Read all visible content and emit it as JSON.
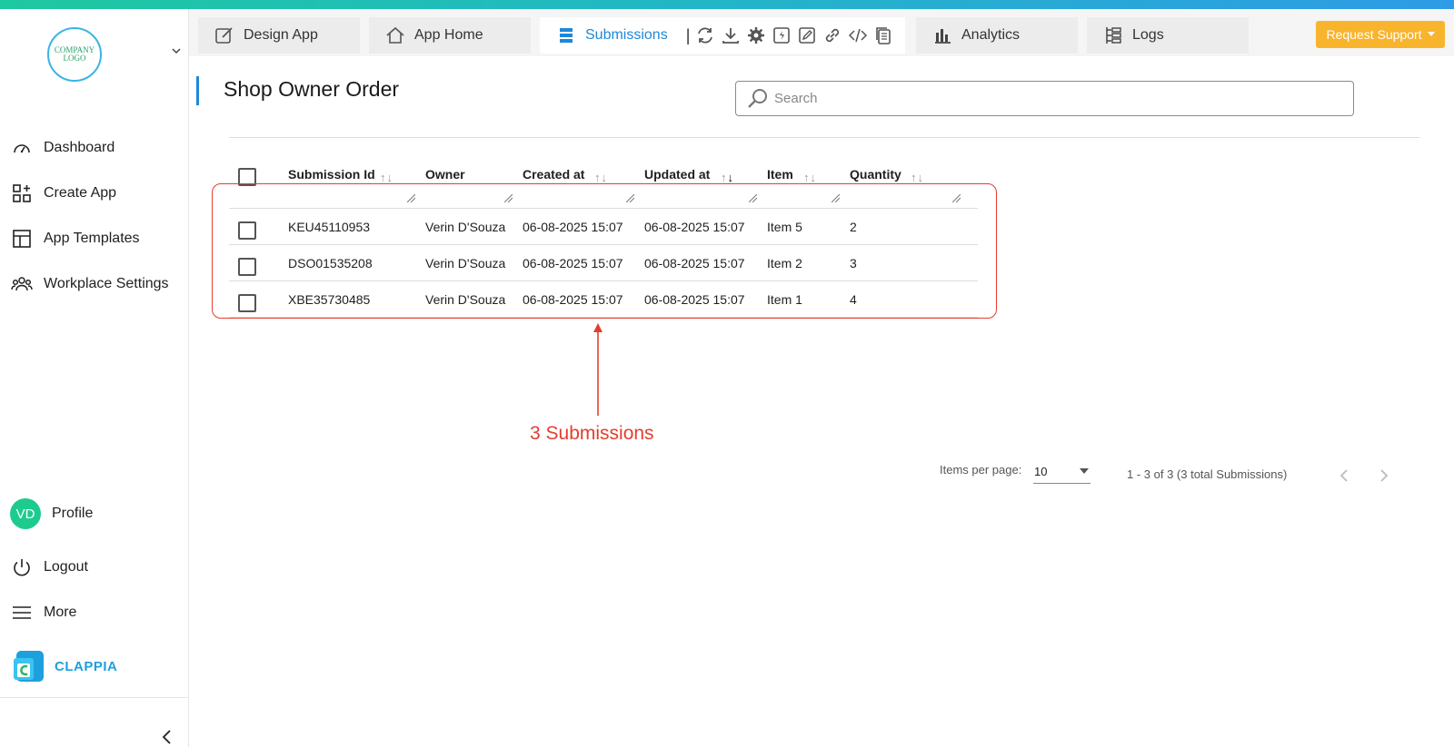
{
  "sidebar": {
    "logo_text": "COMPANY LOGO",
    "items": [
      {
        "label": "Dashboard",
        "icon": "gauge-icon"
      },
      {
        "label": "Create App",
        "icon": "grid-plus-icon"
      },
      {
        "label": "App Templates",
        "icon": "layout-icon"
      },
      {
        "label": "Workplace Settings",
        "icon": "users-icon"
      }
    ],
    "profile": {
      "initials": "VD",
      "label": "Profile"
    },
    "logout": "Logout",
    "more": "More",
    "brand": "CLAPPIA"
  },
  "tabs": {
    "design": "Design App",
    "home": "App Home",
    "submissions": "Submissions",
    "analytics": "Analytics",
    "logs": "Logs"
  },
  "request_support": "Request Support",
  "page": {
    "title": "Shop Owner Order",
    "search_placeholder": "Search"
  },
  "table": {
    "columns": [
      "Submission Id",
      "Owner",
      "Created at",
      "Updated at",
      "Item",
      "Quantity"
    ],
    "rows": [
      [
        "KEU45110953",
        "Verin D'Souza",
        "06-08-2025 15:07",
        "06-08-2025 15:07",
        "Item 5",
        "2"
      ],
      [
        "DSO01535208",
        "Verin D'Souza",
        "06-08-2025 15:07",
        "06-08-2025 15:07",
        "Item 2",
        "3"
      ],
      [
        "XBE35730485",
        "Verin D'Souza",
        "06-08-2025 15:07",
        "06-08-2025 15:07",
        "Item 1",
        "4"
      ]
    ]
  },
  "annotation": "3 Submissions",
  "pagination": {
    "items_per_page_label": "Items per page:",
    "items_per_page": "10",
    "range_text": "1 - 3 of 3 (3 total Submissions)"
  },
  "colors": {
    "accent": "#1e88d8",
    "support": "#f9b42d",
    "annotation": "#e53d2e",
    "avatar": "#1ecb8f"
  }
}
